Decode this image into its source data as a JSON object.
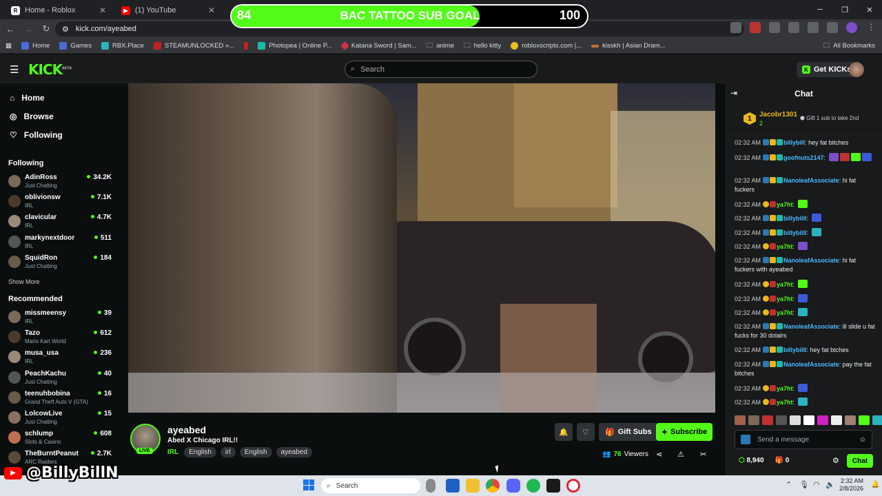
{
  "browser": {
    "tabs": [
      {
        "title": "Home - Roblox"
      },
      {
        "title": "(1) YouTube"
      }
    ],
    "url": "kick.com/ayeabed",
    "bookmarks": [
      "Home",
      "Games",
      "RBX.Place",
      "STEAMUNLOCKED »...",
      "Photopea | Online P...",
      "Katana Sword | Sam...",
      "anime",
      "hello kitty",
      "robloxscripts.com |...",
      "kisskh | Asian Dram..."
    ],
    "all_bookmarks": "All Bookmarks"
  },
  "kick": {
    "logo": "KICK",
    "logo_badge": "BETA",
    "search_placeholder": "Search",
    "get_kicks": "Get KICKs"
  },
  "sidebar": {
    "nav": [
      {
        "label": "Home"
      },
      {
        "label": "Browse"
      },
      {
        "label": "Following"
      }
    ],
    "following_header": "Following",
    "following": [
      {
        "name": "AdinRoss",
        "category": "Just Chatting",
        "viewers": "34.2K"
      },
      {
        "name": "oblivionsw",
        "category": "IRL",
        "viewers": "7.1K"
      },
      {
        "name": "clavicular",
        "category": "IRL",
        "viewers": "4.7K"
      },
      {
        "name": "markynextdoor",
        "category": "IRL",
        "viewers": "511"
      },
      {
        "name": "SquidRon",
        "category": "Just Chatting",
        "viewers": "184"
      }
    ],
    "show_more": "Show More",
    "recommended_header": "Recommended",
    "recommended": [
      {
        "name": "missmeensy",
        "category": "IRL",
        "viewers": "39"
      },
      {
        "name": "Tazo",
        "category": "Mario Kart World",
        "viewers": "612"
      },
      {
        "name": "musa_usa",
        "category": "IRL",
        "viewers": "236"
      },
      {
        "name": "PeachKachu",
        "category": "Just Chatting",
        "viewers": "40"
      },
      {
        "name": "teenuhbobina",
        "category": "Grand Theft Auto V (GTA)",
        "viewers": "16"
      },
      {
        "name": "LolcowLive",
        "category": "Just Chatting",
        "viewers": "15"
      },
      {
        "name": "schlump",
        "category": "Slots & Casino",
        "viewers": "608"
      },
      {
        "name": "TheBurntPeanut",
        "category": "ARC Raiders",
        "viewers": "2.7K"
      }
    ]
  },
  "stream": {
    "channel": "ayeabed",
    "title": "Abed X Chicago IRL!!",
    "live": "LIVE",
    "category": "IRL",
    "tags": [
      "English",
      "irl",
      "English",
      "ayeabed"
    ],
    "gift_subs": "Gift Subs",
    "subscribe": "Subscribe",
    "viewers_count": "76",
    "viewers_label": "Viewers"
  },
  "goal": {
    "current": "84",
    "title": "BAC TATTOO SUB GOAL",
    "target": "100",
    "progress": 0.84
  },
  "chat": {
    "header": "Chat",
    "pinned_user": "Jacobr1301",
    "pinned_count": "2",
    "pinned_text": "Gift 1 sub to take 2nd",
    "messages": [
      {
        "time": "02:32 AM",
        "user": "billybill",
        "text": "hey fat bitches"
      },
      {
        "time": "02:32 AM",
        "user": "goofnuts2147",
        "text": ""
      },
      {
        "time": "02:32 AM",
        "user": "NanoleafAssociate",
        "text": "hi fat fuckers"
      },
      {
        "time": "02:32 AM",
        "user": "ya7ht",
        "text": ""
      },
      {
        "time": "02:32 AM",
        "user": "billybilll",
        "text": ""
      },
      {
        "time": "02:32 AM",
        "user": "billybilll",
        "text": ""
      },
      {
        "time": "02:32 AM",
        "user": "ya7ht",
        "text": ""
      },
      {
        "time": "02:32 AM",
        "user": "NanoleafAssociate",
        "text": "hi fat fuckers with ayeabed"
      },
      {
        "time": "02:32 AM",
        "user": "ya7ht",
        "text": ""
      },
      {
        "time": "02:32 AM",
        "user": "ya7ht",
        "text": ""
      },
      {
        "time": "02:32 AM",
        "user": "ya7ht",
        "text": ""
      },
      {
        "time": "02:32 AM",
        "user": "NanoleafAssociate",
        "text": "ill slide u fat fucks for 30 dolalrs"
      },
      {
        "time": "02:32 AM",
        "user": "billybilll",
        "text": "hey fat btches"
      },
      {
        "time": "02:32 AM",
        "user": "NanoleafAssociate",
        "text": "pay the fat bitches"
      },
      {
        "time": "02:32 AM",
        "user": "ya7ht",
        "text": ""
      },
      {
        "time": "02:32 AM",
        "user": "ya7ht",
        "text": ""
      }
    ],
    "input_placeholder": "Send a message",
    "points": "8,940",
    "gifts": "0",
    "chat_button": "Chat"
  },
  "watermark": "@BillyBillN",
  "taskbar": {
    "search": "Search",
    "time": "2:32 AM",
    "date": "2/8/2026"
  },
  "colors": {
    "accent": "#53fc18",
    "username": "#4db8ff",
    "bg": "#0b0e0f"
  }
}
